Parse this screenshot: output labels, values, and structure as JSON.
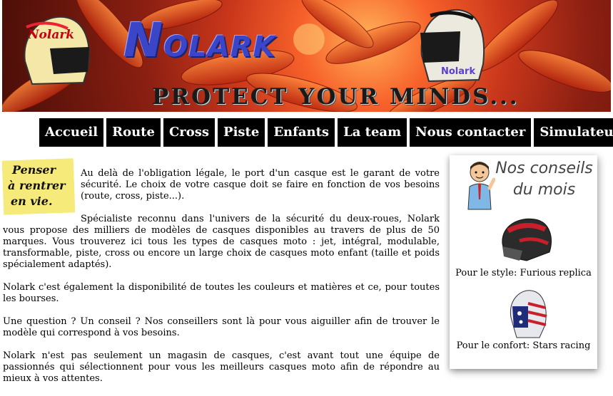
{
  "banner": {
    "logo_big": "N",
    "logo_small": "OLARK",
    "slogan": "PROTECT YOUR MINDS...",
    "helmet_left_text": "Nolark",
    "helmet_right_text": "Nolark"
  },
  "nav": {
    "items": [
      "Accueil",
      "Route",
      "Cross",
      "Piste",
      "Enfants",
      "La team",
      "Nous contacter",
      "Simulateur"
    ]
  },
  "note": {
    "line1": "Penser",
    "line2": "à rentrer",
    "line3": "en vie."
  },
  "content": {
    "paragraphs": [
      "Au delà de l'obligation légale, le port d'un casque est le garant de votre sécurité. Le choix de votre casque doit se faire en fonction de vos besoins (route, cross, piste...).",
      "Spécialiste reconnu dans l'univers de la sécurité du deux-roues, Nolark vous propose des milliers de modèles de casques disponibles au travers de plus de 50 marques. Vous trouverez ici tous les types de casques moto : jet, intégral, modulable, transformable, piste, cross ou encore un large choix de casques moto enfant (taille et poids spécialement adaptés).",
      "Nolark c'est également la disponibilité de toutes les couleurs et matières et ce, pour toutes les bourses.",
      "Une question ? Un conseil ? Nos conseillers sont là pour vous aiguiller afin de trouver le modèle qui correspond à vos besoins.",
      "Nolark n'est pas seulement un magasin de casques, c'est avant tout une équipe de passionnés qui sélectionnent pour vous les meilleurs casques moto afin de répondre au mieux à vos attentes."
    ]
  },
  "sidebar": {
    "title_line1": "Nos conseils",
    "title_line2": "du mois",
    "items": [
      {
        "label": "Pour le style: Furious replica"
      },
      {
        "label": "Pour le confort: Stars racing"
      }
    ]
  },
  "colors": {
    "nav_bg": "#000000",
    "nav_text": "#ffffff",
    "logo_blue": "#3a45c8"
  }
}
